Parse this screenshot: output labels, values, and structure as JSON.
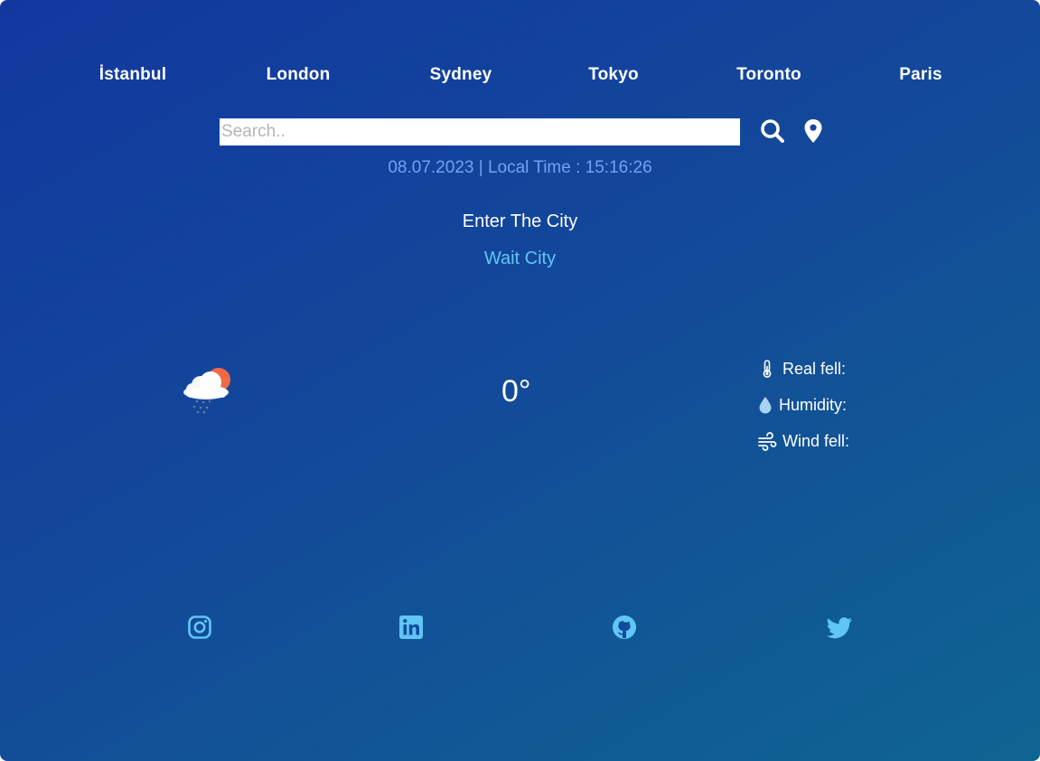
{
  "cities": [
    "İstanbul",
    "London",
    "Sydney",
    "Tokyo",
    "Toronto",
    "Paris"
  ],
  "search": {
    "placeholder": "Search..",
    "value": ""
  },
  "datetime": {
    "date": "08.07.2023",
    "separator": " | ",
    "local_time_label": "Local Time : ",
    "time": "15:16:26"
  },
  "city_title": "Enter The City",
  "city_subtitle": "Wait City",
  "weather": {
    "icon": "cloud-sun-snow-icon",
    "temperature": "0°"
  },
  "details": {
    "real_feel_label": "Real fell:",
    "humidity_label": "Humidity:",
    "wind_label": "Wind fell:"
  },
  "social_icons": [
    "instagram-icon",
    "linkedin-icon",
    "github-icon",
    "twitter-icon"
  ],
  "colors": {
    "accent_light": "#5fc6f5",
    "date_text": "#6fa3f0",
    "sun": "#ef6b45"
  }
}
